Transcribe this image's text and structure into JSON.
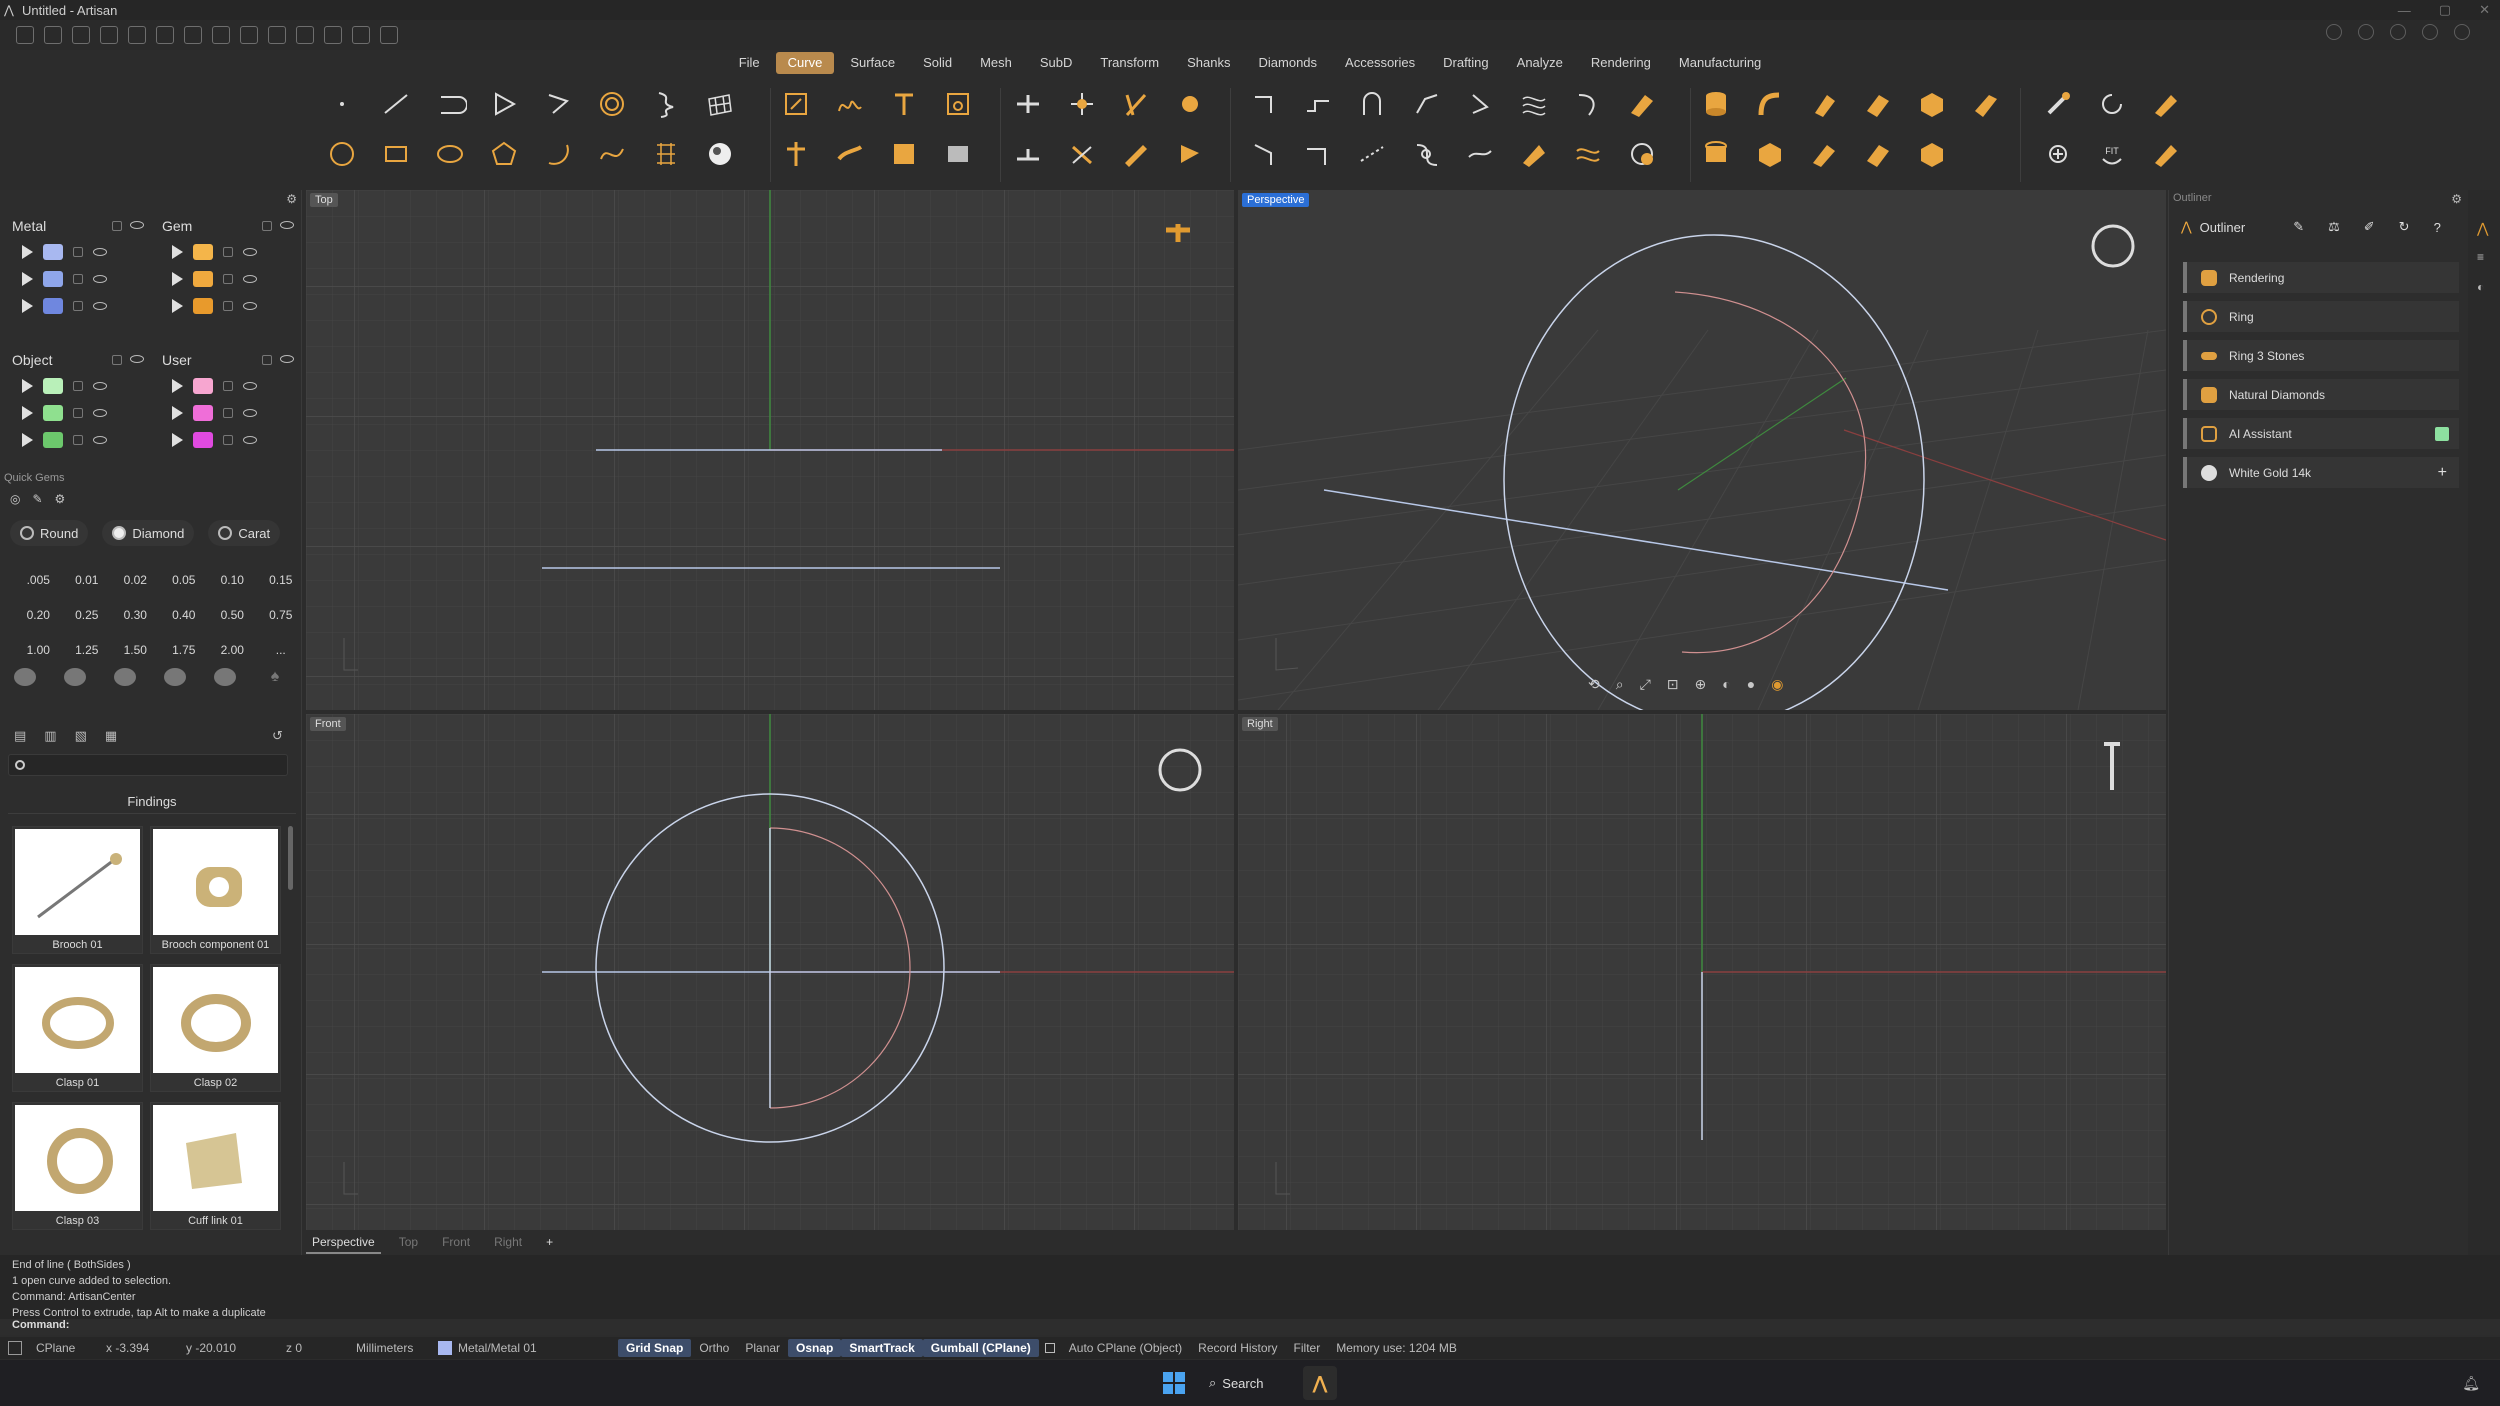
{
  "window": {
    "title": "Untitled - Artisan"
  },
  "menu": [
    "File",
    "Curve",
    "Surface",
    "Solid",
    "Mesh",
    "SubD",
    "Transform",
    "Shanks",
    "Diamonds",
    "Accessories",
    "Drafting",
    "Analyze",
    "Rendering",
    "Manufacturing"
  ],
  "menu_active": "Curve",
  "layers": {
    "metal": {
      "title": "Metal",
      "colors": [
        "#a8b8f0",
        "#8fa6ea",
        "#6f87df"
      ]
    },
    "gem": {
      "title": "Gem",
      "colors": [
        "#f4b54a",
        "#f0a93e",
        "#e89a2c"
      ]
    },
    "object": {
      "title": "Object",
      "colors": [
        "#b9f0b9",
        "#8fe08f",
        "#6cc86c"
      ]
    },
    "user": {
      "title": "User",
      "colors": [
        "#f7a6d0",
        "#ef6ed8",
        "#e04ae0"
      ]
    }
  },
  "quick_gems": {
    "title": "Quick Gems",
    "buttons": [
      "Round",
      "Diamond",
      "Carat"
    ],
    "carats": [
      ".005",
      "0.01",
      "0.02",
      "0.05",
      "0.10",
      "0.15",
      "0.20",
      "0.25",
      "0.30",
      "0.40",
      "0.50",
      "0.75",
      "1.00",
      "1.25",
      "1.50",
      "1.75",
      "2.00",
      "..."
    ]
  },
  "library": {
    "category": "Findings",
    "items": [
      "Brooch 01",
      "Brooch component 01",
      "Clasp 01",
      "Clasp 02",
      "Clasp 03",
      "Cuff link 01"
    ]
  },
  "viewports": {
    "top": "Top",
    "perspective": "Perspective",
    "front": "Front",
    "right": "Right"
  },
  "viewport_tabs": [
    "Perspective",
    "Top",
    "Front",
    "Right",
    "+"
  ],
  "outliner": {
    "panel_label": "Outliner",
    "title": "Outliner",
    "items": [
      "Rendering",
      "Ring",
      "Ring 3 Stones",
      "Natural Diamonds",
      "AI Assistant",
      "White Gold 14k"
    ]
  },
  "command_history": [
    "End of line ( BothSides )",
    "1 open curve added to selection.",
    "Command: ArtisanCenter",
    "Press Control to extrude, tap Alt to make a duplicate"
  ],
  "command_prompt": "Command:",
  "status": {
    "cplane": "CPlane",
    "x": "x -3.394",
    "y": "y -20.010",
    "z": "z 0",
    "units": "Millimeters",
    "layer": "Metal/Metal 01",
    "grid_snap": "Grid Snap",
    "ortho": "Ortho",
    "planar": "Planar",
    "osnap": "Osnap",
    "smarttrack": "SmartTrack",
    "gumball": "Gumball (CPlane)",
    "autocplane": "Auto CPlane (Object)",
    "record": "Record History",
    "filter": "Filter",
    "memory": "Memory use: 1204 MB"
  },
  "taskbar": {
    "search": "Search"
  },
  "colors": {
    "accent": "#b98a4d",
    "active_view": "#2b6fd6",
    "tool_orange": "#f0a93e"
  }
}
